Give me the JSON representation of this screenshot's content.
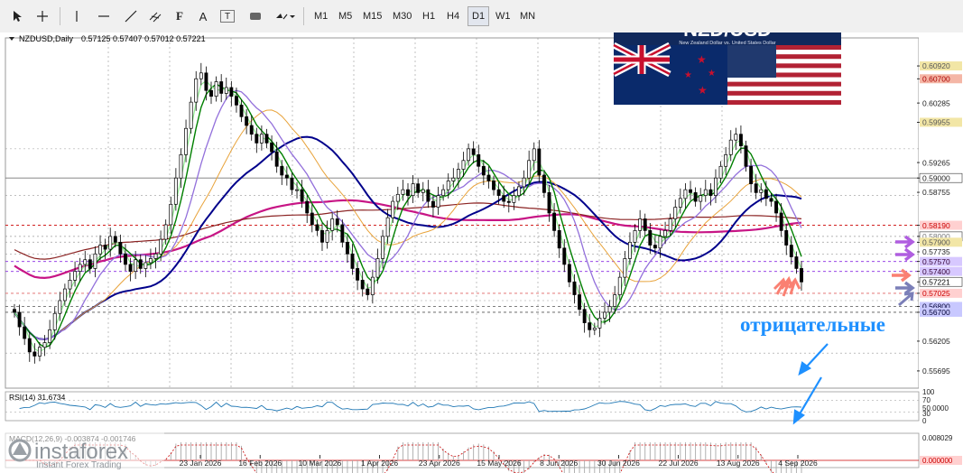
{
  "toolbar": {
    "timeframes": [
      "M1",
      "M5",
      "M15",
      "M30",
      "H1",
      "H4",
      "D1",
      "W1",
      "MN"
    ],
    "active_timeframe": "D1",
    "text_tool": "A",
    "label_tool": "T"
  },
  "banner": {
    "pair": "NZD/USD",
    "subtitle": "New Zealand Dollar vs. United States Dollar"
  },
  "header": {
    "symbol": "NZDUSD,Daily",
    "ohlc": "0.57125 0.57407 0.57012 0.57221"
  },
  "annotation": {
    "text": "отрицательные"
  },
  "brand": {
    "name": "instaforex",
    "tagline": "Instant Forex Trading"
  },
  "colors": {
    "bull": "#000000",
    "bear": "#000000",
    "ma_lightgreen": "#90ee90",
    "ma_green": "#008000",
    "ma_purple": "#9370db",
    "ma_orange": "#e8a33b",
    "ma_navy": "#00008b",
    "ma_magenta": "#c71585",
    "ma_brown": "#8b2323",
    "annotation": "#1e90ff",
    "arrow_purple": "#b05ee0",
    "arrow_salmon": "#fa8072",
    "arrow_slate": "#7b7fb8"
  },
  "chart_data": [
    {
      "type": "candlestick",
      "title": "NZDUSD,Daily",
      "ylim": [
        0.554,
        0.614
      ],
      "y_ticks": [
        "0.60920",
        "0.60700",
        "0.60285",
        "0.59955",
        "0.59265",
        "0.59000",
        "0.58755",
        "0.58190",
        "0.58000",
        "0.57900",
        "0.57735",
        "0.57570",
        "0.57400",
        "0.57221",
        "0.57025",
        "0.56800",
        "0.56700",
        "0.56205",
        "0.55695"
      ],
      "price_levels": [
        {
          "label": "0.60920",
          "value": 0.6092,
          "color": "#f2e6a6",
          "text": "#555"
        },
        {
          "label": "0.60700",
          "value": 0.607,
          "color": "#f4b6a6",
          "text": "#a00"
        },
        {
          "label": "0.59955",
          "value": 0.59955,
          "color": "#f2e6a6",
          "text": "#555"
        },
        {
          "label": "0.59000",
          "value": 0.59,
          "color": "#ffffff",
          "text": "#222"
        },
        {
          "label": "0.58190",
          "value": 0.5819,
          "color": "#ffd0d0",
          "text": "#c00"
        },
        {
          "label": "0.58000",
          "value": 0.58,
          "color": "#ffffff",
          "text": "#777"
        },
        {
          "label": "0.57900",
          "value": 0.579,
          "color": "#f2e6a6",
          "text": "#555"
        },
        {
          "label": "0.57570",
          "value": 0.5757,
          "color": "#d7c8ff",
          "text": "#303"
        },
        {
          "label": "0.57400",
          "value": 0.574,
          "color": "#d7c8ff",
          "text": "#303"
        },
        {
          "label": "0.57221",
          "value": 0.57221,
          "color": "#ffffff",
          "text": "#000"
        },
        {
          "label": "0.57025",
          "value": 0.57025,
          "color": "#ffd0d0",
          "text": "#c00"
        },
        {
          "label": "0.56800",
          "value": 0.568,
          "color": "#c8c8ff",
          "text": "#003"
        },
        {
          "label": "0.56700",
          "value": 0.567,
          "color": "#c8c8ff",
          "text": "#003"
        }
      ],
      "x_ticks": [
        "23 Jan 2026",
        "16 Feb 2026",
        "10 Mar 2026",
        "1 Apr 2026",
        "23 Apr 2026",
        "15 May 2026",
        "8 Jun 2026",
        "30 Jun 2026",
        "22 Jul 2026",
        "13 Aug 2026",
        "4 Sep 2026"
      ],
      "close": [
        0.567,
        0.5645,
        0.5625,
        0.5602,
        0.5595,
        0.561,
        0.5618,
        0.564,
        0.5668,
        0.569,
        0.571,
        0.5725,
        0.574,
        0.5752,
        0.576,
        0.5745,
        0.577,
        0.5785,
        0.5778,
        0.58,
        0.579,
        0.577,
        0.5752,
        0.574,
        0.576,
        0.5745,
        0.5755,
        0.5762,
        0.577,
        0.5795,
        0.582,
        0.5855,
        0.59,
        0.594,
        0.5985,
        0.603,
        0.607,
        0.608,
        0.605,
        0.604,
        0.6065,
        0.6045,
        0.6055,
        0.604,
        0.6025,
        0.6005,
        0.599,
        0.5975,
        0.596,
        0.5975,
        0.596,
        0.5945,
        0.592,
        0.5905,
        0.59,
        0.588,
        0.588,
        0.586,
        0.584,
        0.582,
        0.581,
        0.579,
        0.581,
        0.583,
        0.582,
        0.579,
        0.577,
        0.5745,
        0.5725,
        0.571,
        0.57,
        0.573,
        0.5762,
        0.58,
        0.5832,
        0.586,
        0.5872,
        0.588,
        0.587,
        0.589,
        0.5875,
        0.588,
        0.586,
        0.585,
        0.587,
        0.588,
        0.5895,
        0.59,
        0.5915,
        0.593,
        0.595,
        0.594,
        0.592,
        0.5905,
        0.5895,
        0.588,
        0.587,
        0.586,
        0.5858,
        0.587,
        0.5885,
        0.59,
        0.593,
        0.595,
        0.5905,
        0.5875,
        0.584,
        0.581,
        0.578,
        0.5752,
        0.5722,
        0.57,
        0.5675,
        0.5652,
        0.564,
        0.5643,
        0.566,
        0.567,
        0.568,
        0.57,
        0.573,
        0.5762,
        0.579,
        0.581,
        0.583,
        0.581,
        0.5785,
        0.578,
        0.58,
        0.581,
        0.583,
        0.585,
        0.5865,
        0.588,
        0.5875,
        0.586,
        0.587,
        0.588,
        0.587,
        0.59,
        0.592,
        0.594,
        0.5965,
        0.5975,
        0.5955,
        0.592,
        0.589,
        0.5875,
        0.588,
        0.5865,
        0.586,
        0.584,
        0.581,
        0.5785,
        0.5765,
        0.5745,
        0.5722
      ],
      "series": [
        {
          "color_key": "ma_lightgreen",
          "values": [
            0.566,
            0.565,
            0.5642,
            0.564,
            0.5648,
            0.566,
            0.5675,
            0.5692,
            0.571,
            0.5722,
            0.5735,
            0.5748,
            0.5752,
            0.5748,
            0.5742,
            0.5738,
            0.5745,
            0.5762,
            0.5805,
            0.586,
            0.592,
            0.5975,
            0.6015,
            0.6035,
            0.604,
            0.6035,
            0.6025,
            0.601,
            0.599,
            0.597,
            0.595,
            0.593,
            0.5905,
            0.588,
            0.586,
            0.584,
            0.5822,
            0.5808,
            0.5795,
            0.5785,
            0.577,
            0.5752,
            0.5738,
            0.573,
            0.575,
            0.579,
            0.583,
            0.586,
            0.5875,
            0.588,
            0.5882,
            0.5885,
            0.5895,
            0.5912,
            0.593,
            0.5942,
            0.5935,
            0.5918,
            0.59,
            0.5885,
            0.587,
            0.5862,
            0.586,
            0.5872,
            0.5895,
            0.5925,
            0.5932,
            0.5895,
            0.5845,
            0.579,
            0.5745,
            0.5705,
            0.5675,
            0.5655,
            0.565,
            0.566,
            0.569,
            0.5725,
            0.576,
            0.579,
            0.581,
            0.5815,
            0.5805,
            0.58,
            0.5812,
            0.5832,
            0.5852,
            0.5872,
            0.5885,
            0.589,
            0.5898,
            0.5915,
            0.594,
            0.5958,
            0.5945,
            0.5915,
            0.5885,
            0.5865,
            0.585,
            0.5832,
            0.5812,
            0.579,
            0.5765
          ]
        }
      ]
    }
  ]
}
